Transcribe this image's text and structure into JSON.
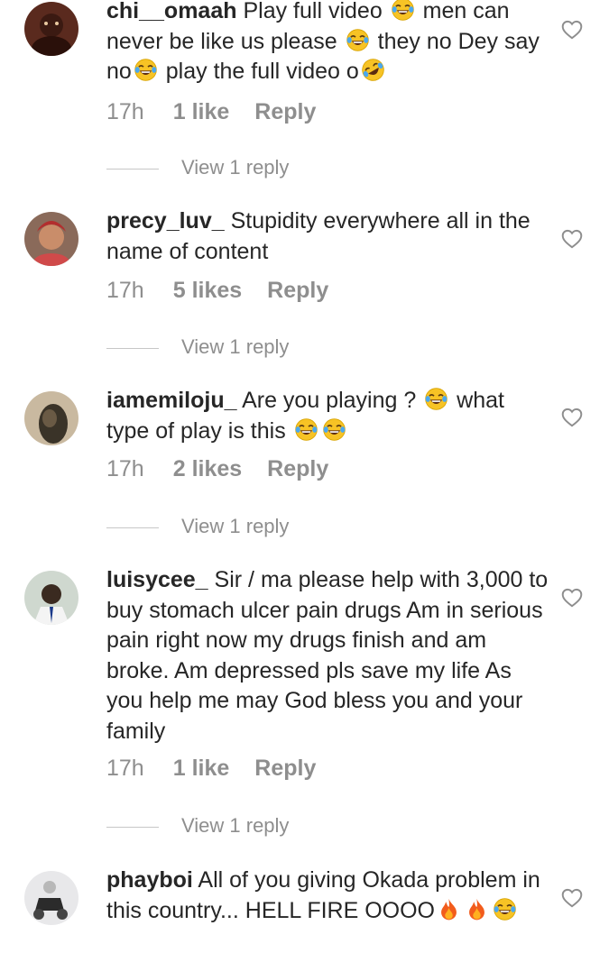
{
  "comments": [
    {
      "username": "chi__omaah",
      "segments": [
        "Play full video ",
        " men can never be like us please ",
        " they no Dey say no",
        " play the full video o",
        ""
      ],
      "emojis": [
        "tears-of-joy-emoji",
        "tears-of-joy-emoji",
        "tears-of-joy-emoji",
        "rofl-emoji"
      ],
      "time": "17h",
      "likes": "1 like",
      "reply": "Reply",
      "view_replies": "View 1 reply"
    },
    {
      "username": "precy_luv_",
      "segments": [
        "Stupidity everywhere all in the name of content"
      ],
      "emojis": [],
      "time": "17h",
      "likes": "5 likes",
      "reply": "Reply",
      "view_replies": "View 1 reply"
    },
    {
      "username": "iamemiloju_",
      "segments": [
        "Are you playing ? ",
        " what type of play is this ",
        "",
        ""
      ],
      "emojis": [
        "tears-of-joy-emoji",
        "tears-of-joy-emoji",
        "tears-of-joy-emoji"
      ],
      "time": "17h",
      "likes": "2 likes",
      "reply": "Reply",
      "view_replies": "View 1 reply"
    },
    {
      "username": "luisycee_",
      "segments": [
        "Sir / ma please help with 3,000 to buy stomach ulcer pain drugs Am in serious pain right now my drugs finish and am broke. Am depressed pls save my life As you help me may God bless you and your family"
      ],
      "emojis": [],
      "time": "17h",
      "likes": "1 like",
      "reply": "Reply",
      "view_replies": "View 1 reply"
    },
    {
      "username": "phayboi",
      "segments": [
        "All of you giving Okada problem in this country... HELL FIRE OOOO",
        "",
        "",
        ""
      ],
      "emojis": [
        "fire-emoji",
        "fire-emoji",
        "tears-of-joy-emoji"
      ],
      "time": "",
      "likes": "",
      "reply": "",
      "view_replies": ""
    }
  ],
  "colors": {
    "text": "#262626",
    "muted": "#8e8e8e",
    "divider": "#c7c7c7"
  }
}
